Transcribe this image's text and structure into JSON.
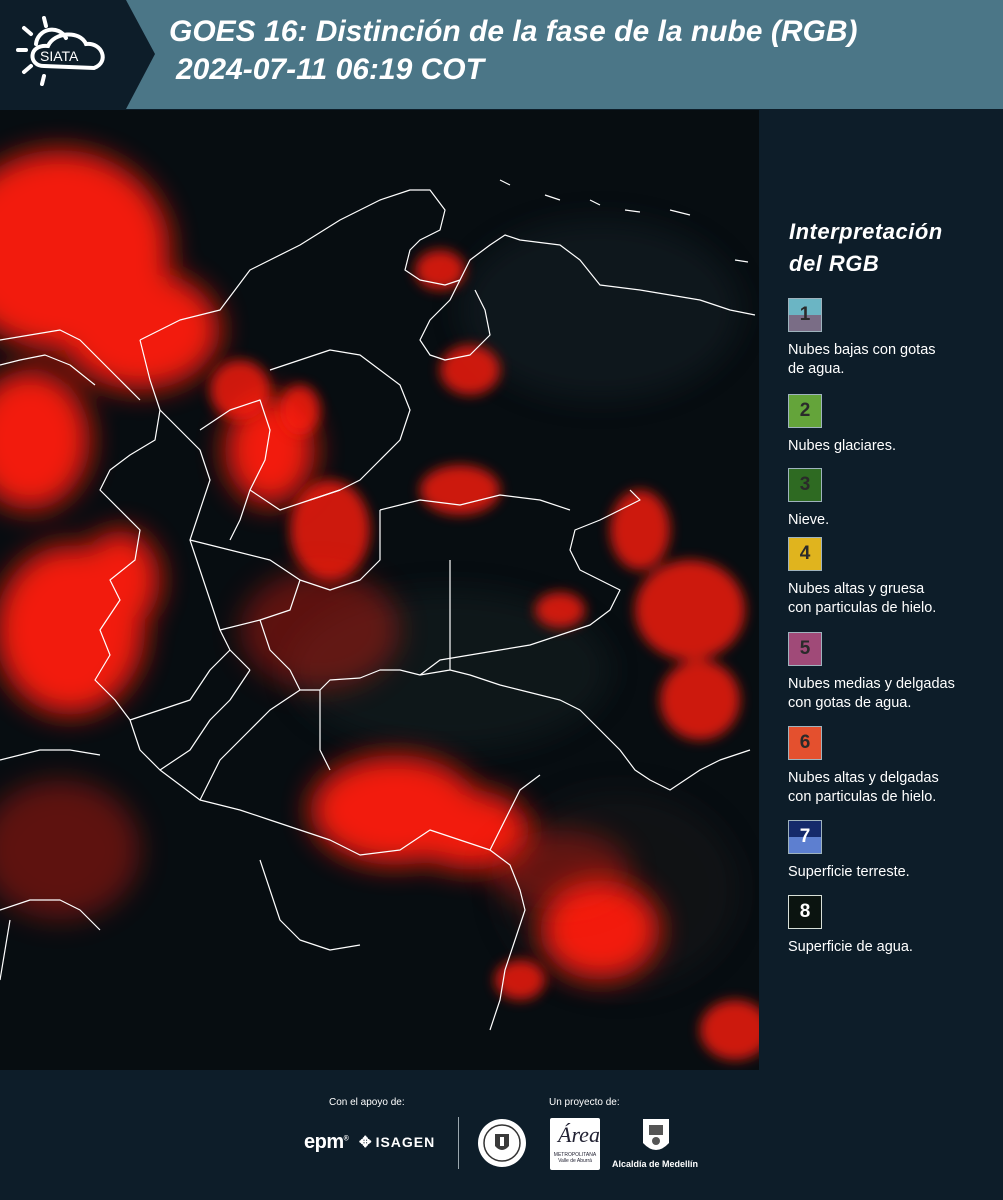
{
  "header": {
    "logo_text": "SIATA",
    "title_line1": "GOES 16: Distinción de la fase de la nube (RGB)",
    "title_line2": "2024-07-11 06:19 COT"
  },
  "legend": {
    "title_line1": "Interpretación",
    "title_line2": "del RGB",
    "items": [
      {
        "number": "1",
        "label_line1": "Nubes bajas con gotas",
        "label_line2": "de agua.",
        "color_top": "#6bb5c4",
        "color_bottom": "#7a6d86"
      },
      {
        "number": "2",
        "label_line1": "Nubes glaciares.",
        "label_line2": "",
        "color_top": "#64a43a",
        "color_bottom": "#64a43a"
      },
      {
        "number": "3",
        "label_line1": "Nieve.",
        "label_line2": "",
        "color_top": "#2e6a22",
        "color_bottom": "#2e6a22"
      },
      {
        "number": "4",
        "label_line1": "Nubes altas y gruesa",
        "label_line2": "con particulas de hielo.",
        "color_top": "#e0b41e",
        "color_bottom": "#e0b41e"
      },
      {
        "number": "5",
        "label_line1": "Nubes medias y delgadas",
        "label_line2": "con gotas de agua.",
        "color_top": "#a04a78",
        "color_bottom": "#a04a78"
      },
      {
        "number": "6",
        "label_line1": "Nubes altas y delgadas",
        "label_line2": "con particulas de hielo.",
        "color_top": "#e4502e",
        "color_bottom": "#e4502e"
      },
      {
        "number": "7",
        "label_line1": "Superficie terreste.",
        "label_line2": "",
        "color_top": "#152a6b",
        "color_bottom": "#5d7fd0"
      },
      {
        "number": "8",
        "label_line1": "Superficie de agua.",
        "label_line2": "",
        "color_top": "#0b1410",
        "color_bottom": "#0b1410"
      }
    ]
  },
  "footer": {
    "support_label": "Con el apoyo de:",
    "project_label": "Un proyecto de:",
    "epm": "epm",
    "isagen": "ISAGEN",
    "area_logo_word": "Área",
    "area_logo_sub": "METROPOLITANA Valle de Aburrá",
    "alcaldia": "Alcaldía de Medellín"
  },
  "colors": {
    "header_bg": "#4b7687",
    "panel_bg": "#0d1d29",
    "cloud_red": "#ff1a10",
    "boundary": "#ffffff"
  }
}
